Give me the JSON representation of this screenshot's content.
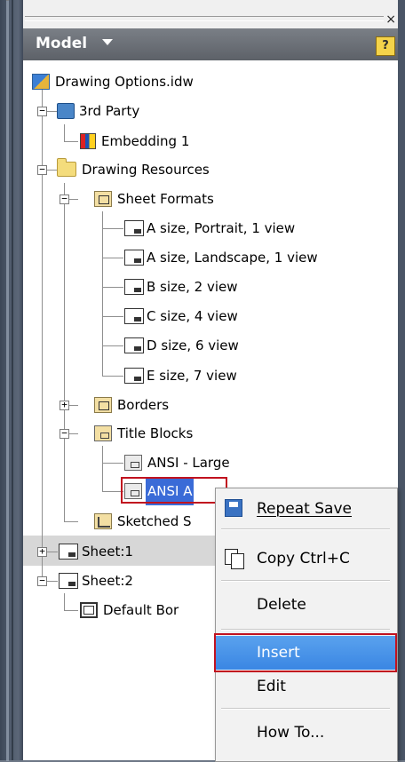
{
  "header": {
    "title": "Model",
    "help_label": "?"
  },
  "topstrip": {
    "close_label": "×"
  },
  "tree": {
    "root": "Drawing Options.idw",
    "third_party": "3rd Party",
    "embedding": "Embedding 1",
    "resources": "Drawing Resources",
    "sheet_formats": "Sheet Formats",
    "formats": [
      "A size, Portrait, 1 view",
      "A size, Landscape, 1 view",
      "B size, 2 view",
      "C size, 4 view",
      "D size, 6 view",
      "E size, 7 view"
    ],
    "borders": "Borders",
    "title_blocks": "Title Blocks",
    "title_block_items": [
      "ANSI - Large",
      "ANSI A"
    ],
    "sketched": "Sketched S",
    "sheet1": "Sheet:1",
    "sheet2": "Sheet:2",
    "default_border": "Default Bor"
  },
  "context_menu": {
    "repeat_save": "Repeat Save",
    "copy": "Copy  Ctrl+C",
    "delete": "Delete",
    "insert": "Insert",
    "edit": "Edit",
    "how_to": "How To..."
  }
}
